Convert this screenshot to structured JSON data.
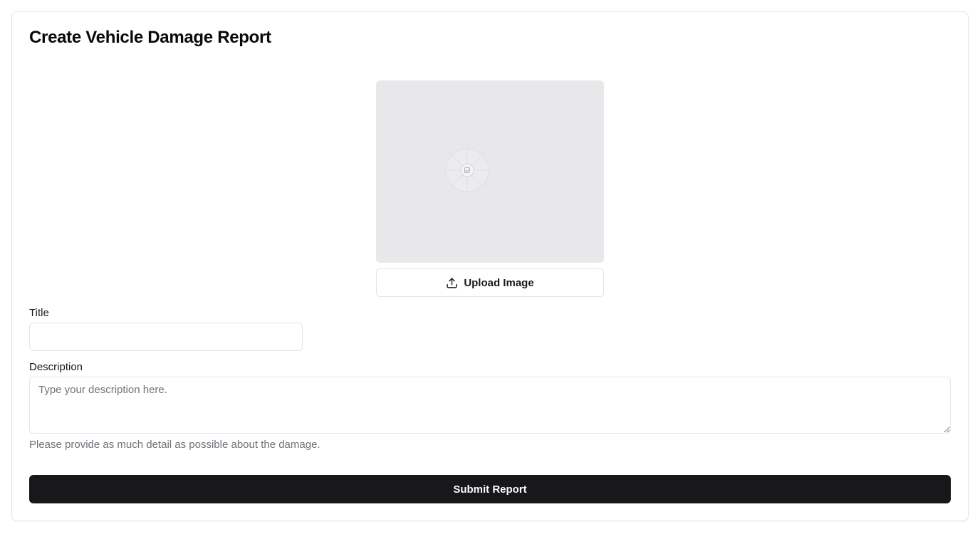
{
  "card": {
    "title": "Create Vehicle Damage Report"
  },
  "image_upload": {
    "placeholder_icon": "image-placeholder-icon",
    "button_icon": "upload-icon",
    "button_label": "Upload Image"
  },
  "form": {
    "title_label": "Title",
    "title_value": "",
    "title_placeholder": "",
    "description_label": "Description",
    "description_value": "",
    "description_placeholder": "Type your description here.",
    "description_helper": "Please provide as much detail as possible about the damage.",
    "submit_label": "Submit Report"
  },
  "colors": {
    "primary": "#18181b",
    "border": "#e4e4e7",
    "muted_text": "#71717a",
    "image_placeholder_bg": "#e8e8ea"
  }
}
